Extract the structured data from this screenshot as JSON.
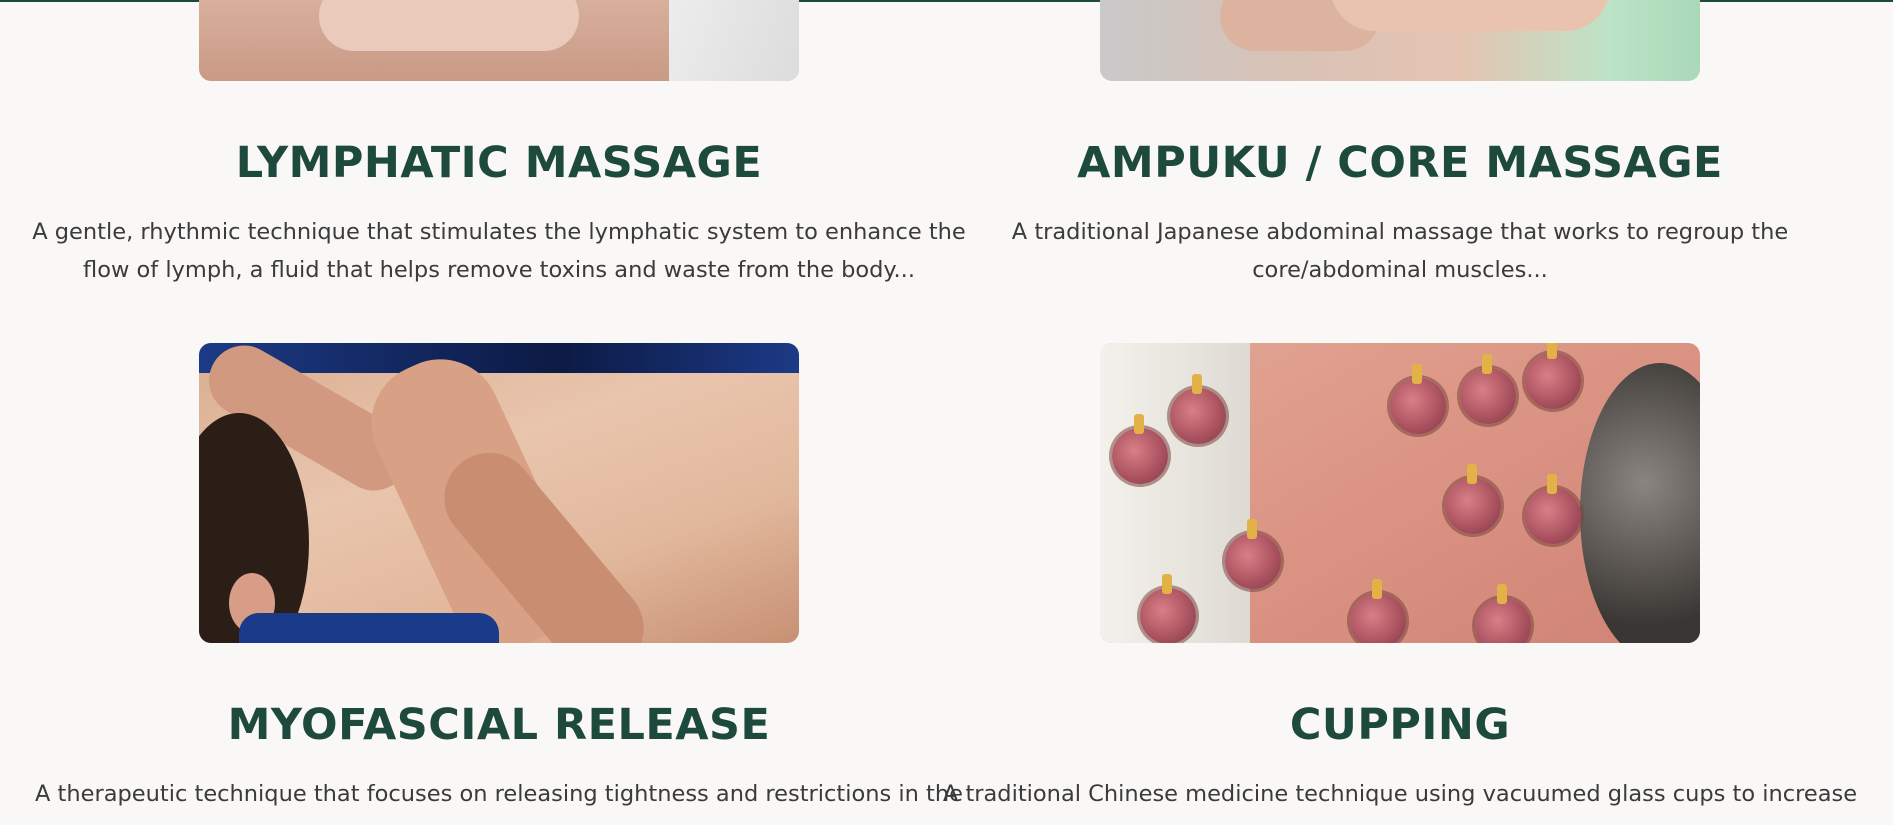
{
  "services": [
    {
      "title": "LYMPHATIC MASSAGE",
      "description_line1": "A gentle, rhythmic technique that stimulates the lymphatic system to enhance the",
      "description_line2": "flow of lymph, a fluid that helps remove toxins and waste from the body..."
    },
    {
      "title": "AMPUKU / CORE MASSAGE",
      "description_line1": "A traditional Japanese abdominal massage that works to regroup the",
      "description_line2": "core/abdominal muscles..."
    },
    {
      "title": "MYOFASCIAL RELEASE",
      "description_line1": "A therapeutic technique that focuses on releasing tightness and restrictions in the",
      "description_line2": ""
    },
    {
      "title": "CUPPING",
      "description_line1": "A traditional Chinese medicine technique using vacuumed glass cups to increase",
      "description_line2": ""
    }
  ],
  "colors": {
    "background": "#faf8f6",
    "heading": "#1e4a3e",
    "body_text": "#3b3b3b"
  }
}
